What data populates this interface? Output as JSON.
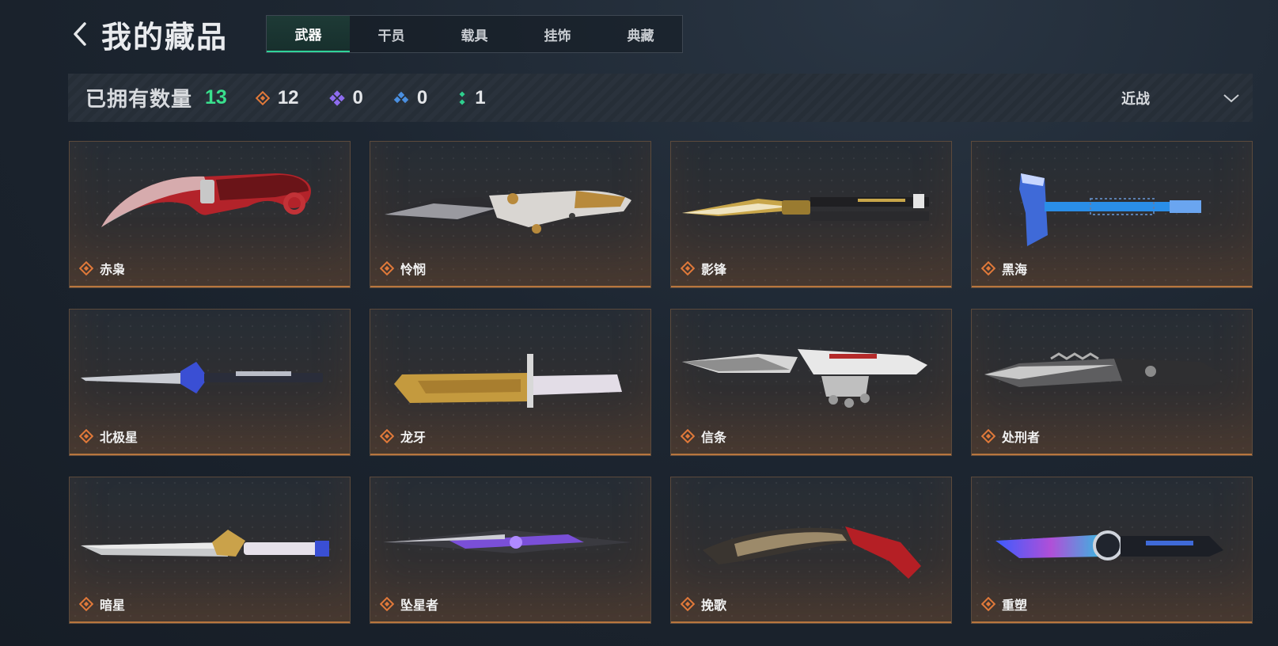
{
  "header": {
    "title": "我的藏品",
    "back_icon": "chevron-left-icon"
  },
  "tabs": [
    {
      "label": "武器",
      "active": true
    },
    {
      "label": "干员",
      "active": false
    },
    {
      "label": "载具",
      "active": false
    },
    {
      "label": "挂饰",
      "active": false
    },
    {
      "label": "典藏",
      "active": false
    }
  ],
  "summary": {
    "owned_label": "已拥有数量",
    "owned_count": "13",
    "rarity_counts": [
      {
        "icon": "orange-diamond-icon",
        "color": "#e0793a",
        "count": "12"
      },
      {
        "icon": "purple-diamond-icon",
        "color": "#8e6cf0",
        "count": "0"
      },
      {
        "icon": "blue-diamond-icon",
        "color": "#4a8fe0",
        "count": "0"
      },
      {
        "icon": "green-dots-icon",
        "color": "#2fcf8e",
        "count": "1"
      }
    ],
    "filter": {
      "value": "近战",
      "icon": "chevron-down-icon"
    }
  },
  "colors": {
    "accent_green": "#39e08d",
    "card_border": "#5c4a3c",
    "rarity_orange": "#e0793a"
  },
  "items": [
    {
      "name": "赤枭",
      "icon": "karambit-knife-icon"
    },
    {
      "name": "怜悯",
      "icon": "knife-icon"
    },
    {
      "name": "影锋",
      "icon": "butterfly-knife-icon"
    },
    {
      "name": "黑海",
      "icon": "tactical-axe-icon"
    },
    {
      "name": "北极星",
      "icon": "stiletto-knife-icon"
    },
    {
      "name": "龙牙",
      "icon": "bayonet-knife-icon"
    },
    {
      "name": "信条",
      "icon": "knuckle-knife-icon"
    },
    {
      "name": "处刑者",
      "icon": "serrated-knife-icon"
    },
    {
      "name": "暗星",
      "icon": "dagger-icon"
    },
    {
      "name": "坠星者",
      "icon": "blade-icon"
    },
    {
      "name": "挽歌",
      "icon": "kukri-knife-icon"
    },
    {
      "name": "重塑",
      "icon": "tanto-knife-icon"
    }
  ]
}
